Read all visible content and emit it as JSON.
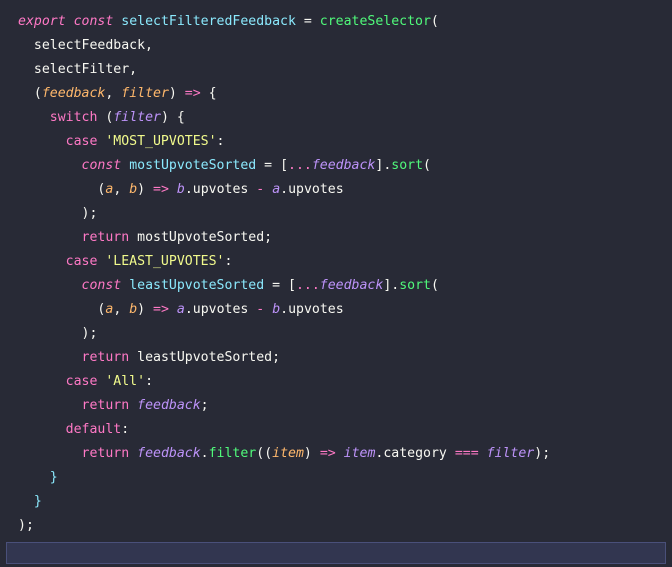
{
  "kw": {
    "export": "export",
    "const": "const",
    "switch": "switch",
    "case": "case",
    "return": "return",
    "default": "default"
  },
  "sym": {
    "eq": " = ",
    "eqop": " = ",
    "lparen": "(",
    "rparen": ")",
    "lbrace": "{",
    "rbrace": "}",
    "lbrack": "[",
    "rbrack": "]",
    "comma": ", ",
    "commaNoSpace": ",",
    "semi": ";",
    "colon": ":",
    "arrow": " => ",
    "spread": "...",
    "dot": ".",
    "minus": " - ",
    "tripleEq": " === "
  },
  "ident": {
    "selectFilteredFeedback": "selectFilteredFeedback",
    "createSelector": "createSelector",
    "selectFeedback": "selectFeedback",
    "selectFilter": "selectFilter",
    "feedback": "feedback",
    "filter": "filter",
    "mostUpvoteSorted": "mostUpvoteSorted",
    "leastUpvoteSorted": "leastUpvoteSorted",
    "a": "a",
    "b": "b",
    "item": "item",
    "sort": "sort",
    "upvotes": "upvotes",
    "filterFn": "filter",
    "category": "category"
  },
  "str": {
    "mostUpvotes": "'MOST_UPVOTES'",
    "leastUpvotes": "'LEAST_UPVOTES'",
    "all": "'All'"
  }
}
